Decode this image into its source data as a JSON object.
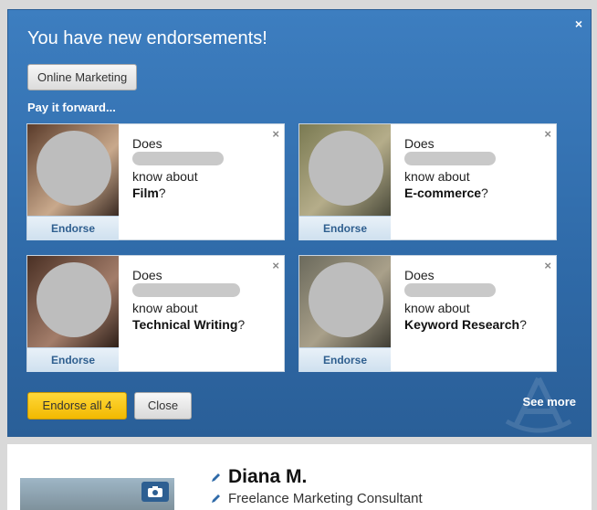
{
  "panel": {
    "title": "You have new endorsements!",
    "close_glyph": "×",
    "skill_tag": "Online Marketing",
    "pay_forward": "Pay it forward...",
    "endorse_all_label": "Endorse all 4",
    "close_label": "Close",
    "see_more_label": "See more"
  },
  "cards": [
    {
      "does": "Does",
      "know": "know about",
      "skill": "Film",
      "q": "?",
      "endorse": "Endorse",
      "dismiss": "×"
    },
    {
      "does": "Does",
      "know": "know about",
      "skill": "E-commerce",
      "q": "?",
      "endorse": "Endorse",
      "dismiss": "×"
    },
    {
      "does": "Does",
      "know": "know about",
      "skill": "Technical Writing",
      "q": "?",
      "endorse": "Endorse",
      "dismiss": "×"
    },
    {
      "does": "Does",
      "know": "know about",
      "skill": "Keyword Research",
      "q": "?",
      "endorse": "Endorse",
      "dismiss": "×"
    }
  ],
  "profile": {
    "name": "Diana M.",
    "headline": "Freelance Marketing Consultant"
  },
  "colors": {
    "panel_blue": "#3d7ec0",
    "endorse_yellow": "#f2b900",
    "link_blue": "#2f5f8f"
  },
  "icons": [
    "close-icon",
    "pencil-icon",
    "camera-icon"
  ]
}
